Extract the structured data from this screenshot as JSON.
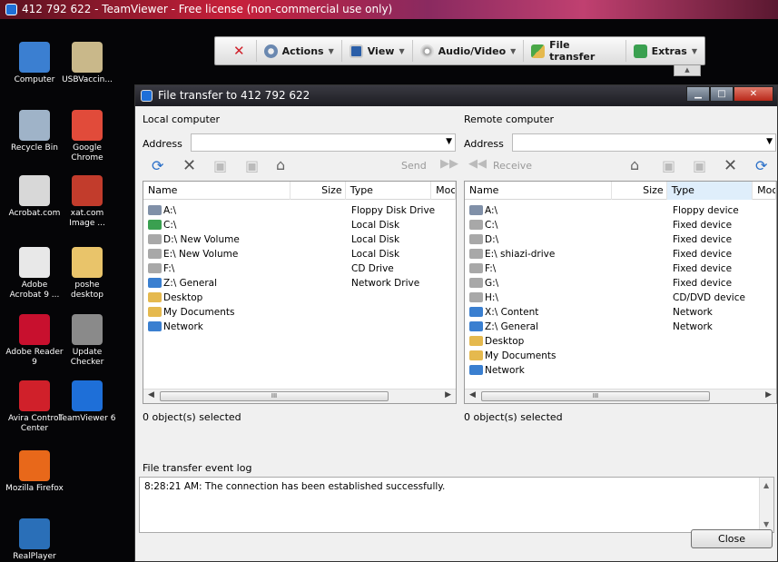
{
  "app_title": "412 792 622 - TeamViewer - Free license (non-commercial use only)",
  "toolbar": {
    "actions": "Actions",
    "view": "View",
    "audio_video": "Audio/Video",
    "file_transfer": "File transfer",
    "extras": "Extras"
  },
  "desktop_icons": [
    {
      "label": "Computer",
      "icon": "computer-icon",
      "color": "#3b7fd1"
    },
    {
      "label": "USBVaccin...",
      "icon": "syringe-icon",
      "color": "#c9b88a"
    },
    {
      "label": "Recycle Bin",
      "icon": "recycle-bin-icon",
      "color": "#9fb3c8"
    },
    {
      "label": "Google Chrome",
      "icon": "chrome-icon",
      "color": "#e14b3a"
    },
    {
      "label": "Acrobat.com",
      "icon": "acrobat-com-icon",
      "color": "#d8d8d8"
    },
    {
      "label": "xat.com Image ...",
      "icon": "xat-image-icon",
      "color": "#c23c2c"
    },
    {
      "label": "Adobe Acrobat 9 ...",
      "icon": "adobe-acrobat-icon",
      "color": "#e8e8e8"
    },
    {
      "label": "poshe desktop",
      "icon": "folder-icon",
      "color": "#e9c46a"
    },
    {
      "label": "Adobe Reader 9",
      "icon": "adobe-reader-icon",
      "color": "#c8102e"
    },
    {
      "label": "Update Checker",
      "icon": "update-checker-icon",
      "color": "#8a8a8a"
    },
    {
      "label": "Avira Control Center",
      "icon": "avira-icon",
      "color": "#d0202a"
    },
    {
      "label": "TeamViewer 6",
      "icon": "teamviewer-icon",
      "color": "#1e6fd8"
    },
    {
      "label": "Mozilla Firefox",
      "icon": "firefox-icon",
      "color": "#e8681a"
    },
    {
      "label": "RealPlayer",
      "icon": "realplayer-icon",
      "color": "#2a6fb8"
    }
  ],
  "window": {
    "title": "File transfer to 412 792 622",
    "local_label": "Local computer",
    "remote_label": "Remote computer",
    "address_label": "Address",
    "send_label": "Send",
    "receive_label": "Receive",
    "local_columns": [
      "Name",
      "Size",
      "Type",
      "Moc"
    ],
    "remote_columns": [
      "Name",
      "Size",
      "Type",
      "Moc"
    ],
    "local_rows": [
      {
        "name": "A:\\",
        "type": "Floppy Disk Drive",
        "icon": "floppy-icon"
      },
      {
        "name": "C:\\",
        "type": "Local Disk",
        "icon": "windows-disk-icon"
      },
      {
        "name": "D:\\ New Volume",
        "type": "Local Disk",
        "icon": "disk-icon"
      },
      {
        "name": "E:\\ New Volume",
        "type": "Local Disk",
        "icon": "disk-icon"
      },
      {
        "name": "F:\\",
        "type": "CD Drive",
        "icon": "cd-drive-icon"
      },
      {
        "name": "Z:\\ General",
        "type": "Network Drive",
        "icon": "network-drive-icon"
      },
      {
        "name": "Desktop",
        "type": "",
        "icon": "desktop-folder-icon"
      },
      {
        "name": "My Documents",
        "type": "",
        "icon": "documents-folder-icon"
      },
      {
        "name": "Network",
        "type": "",
        "icon": "network-icon"
      }
    ],
    "remote_rows": [
      {
        "name": "A:\\",
        "type": "Floppy device",
        "icon": "floppy-icon"
      },
      {
        "name": "C:\\",
        "type": "Fixed device",
        "icon": "disk-icon"
      },
      {
        "name": "D:\\",
        "type": "Fixed device",
        "icon": "disk-icon"
      },
      {
        "name": "E:\\ shiazi-drive",
        "type": "Fixed device",
        "icon": "disk-icon"
      },
      {
        "name": "F:\\",
        "type": "Fixed device",
        "icon": "disk-icon"
      },
      {
        "name": "G:\\",
        "type": "Fixed device",
        "icon": "disk-icon"
      },
      {
        "name": "H:\\",
        "type": "CD/DVD device",
        "icon": "cd-drive-icon"
      },
      {
        "name": "X:\\ Content",
        "type": "Network",
        "icon": "network-drive-icon"
      },
      {
        "name": "Z:\\ General",
        "type": "Network",
        "icon": "network-drive-icon"
      },
      {
        "name": "Desktop",
        "type": "",
        "icon": "desktop-folder-icon"
      },
      {
        "name": "My Documents",
        "type": "",
        "icon": "documents-folder-icon"
      },
      {
        "name": "Network",
        "type": "",
        "icon": "network-icon"
      }
    ],
    "local_status": "0 object(s) selected",
    "remote_status": "0 object(s) selected",
    "log_label": "File transfer event log",
    "log_entry": "8:28:21 AM: The connection has been established successfully.",
    "close_label": "Close"
  },
  "colors": {
    "icon_disk": "#a8a8a8",
    "icon_floppy": "#8090a8",
    "icon_folder": "#e5b94e",
    "icon_network": "#3a7fd0",
    "icon_windows": "#3aa050"
  }
}
